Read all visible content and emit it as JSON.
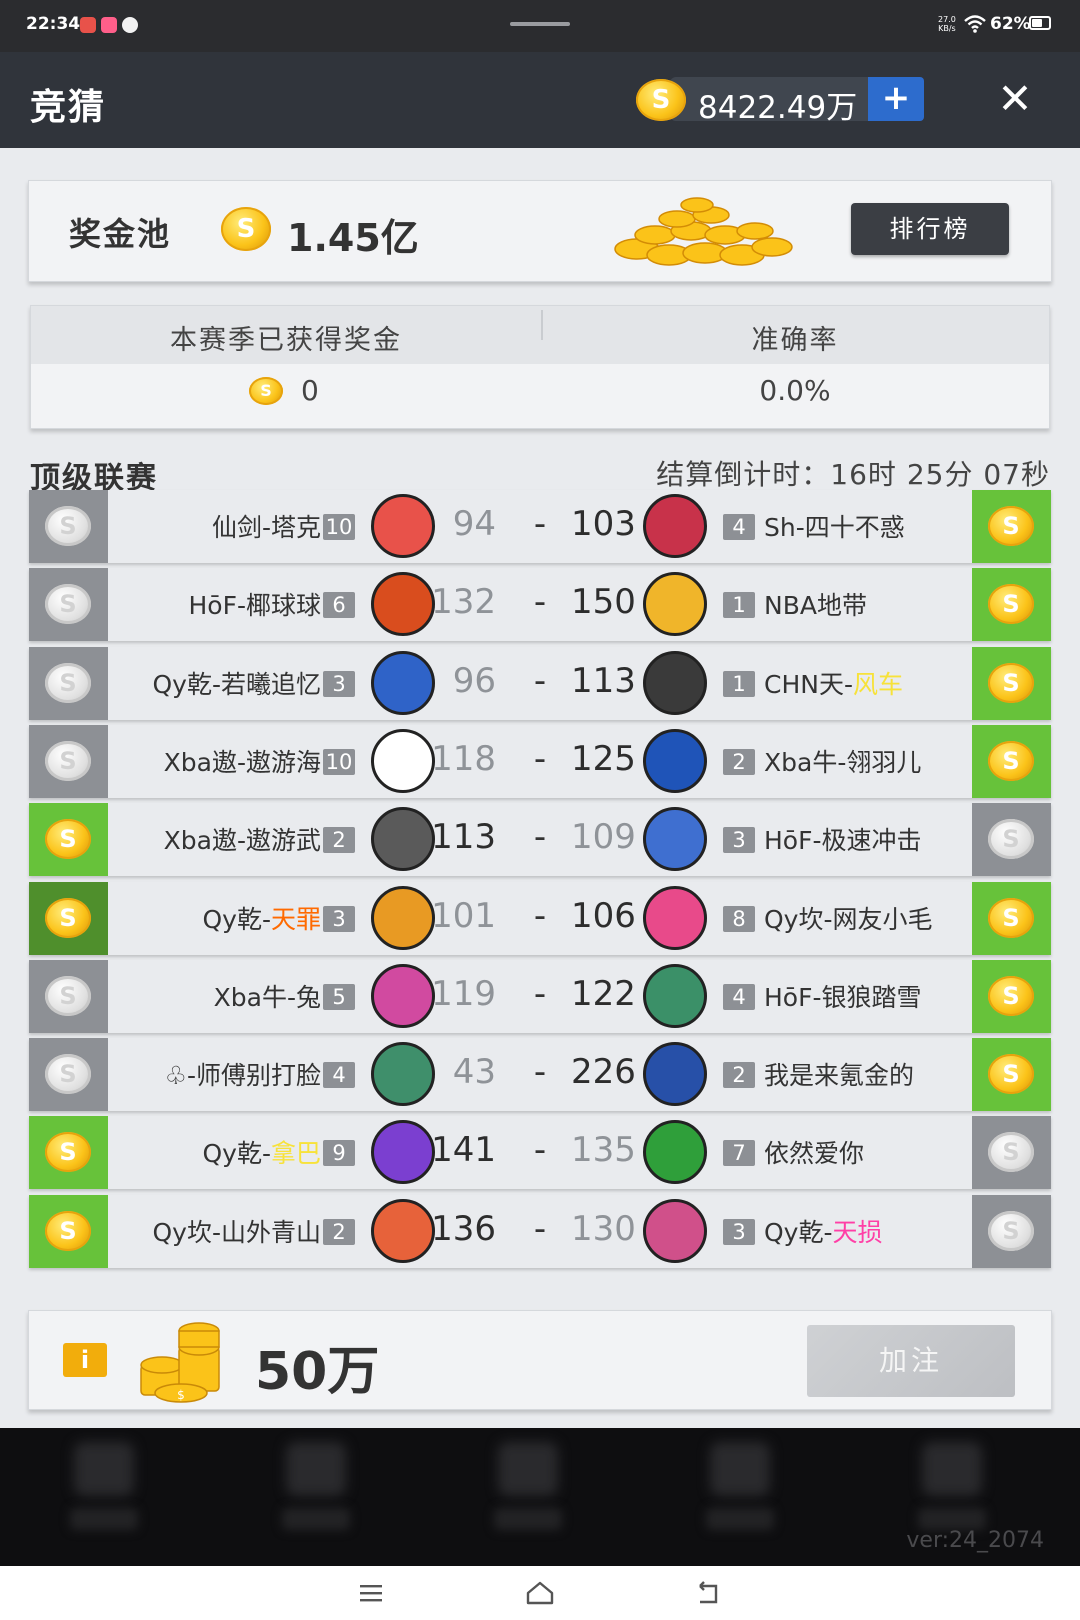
{
  "status_bar": {
    "time": "22:34",
    "net_speed_value": "27.0",
    "net_speed_unit": "KB/s",
    "battery": "62%",
    "battery_level": 0.62
  },
  "header": {
    "title": "竞猜",
    "balance": "8422.49万",
    "add_label": "+",
    "close_label": "✕"
  },
  "pool": {
    "label": "奖金池",
    "value": "1.45亿",
    "rank_label": "排行榜"
  },
  "stats": {
    "earned_label": "本赛季已获得奖金",
    "earned_value": "0",
    "accuracy_label": "准确率",
    "accuracy_value": "0.0%"
  },
  "league": {
    "title": "顶级联赛",
    "countdown": "结算倒计时：16时 25分 07秒"
  },
  "matches": [
    {
      "home_name": "仙剑-塔克",
      "home_level": "10",
      "home_score": "94",
      "away_score": "103",
      "away_level": "4",
      "away_name": "Sh",
      "away_suffix": "-四十不惑",
      "winner": "away"
    },
    {
      "home_name": "HōF-椰球球",
      "home_level": "6",
      "home_score": "132",
      "away_score": "150",
      "away_level": "1",
      "away_name": "NBA地带",
      "winner": "away"
    },
    {
      "home_name": "Qy乾-若曦追忆",
      "home_level": "3",
      "home_score": "96",
      "away_score": "113",
      "away_level": "1",
      "away_name": "CHN天-",
      "away_highlight": "风车",
      "winner": "away"
    },
    {
      "home_name": "Xba遨-遨游海",
      "home_level": "10",
      "home_score": "118",
      "away_score": "125",
      "away_level": "2",
      "away_name": "Xba牛-翎羽儿",
      "winner": "away"
    },
    {
      "home_name": "Xba遨-遨游武",
      "home_level": "2",
      "home_score": "113",
      "away_score": "109",
      "away_level": "3",
      "away_name": "HōF-极速冲击",
      "winner": "home"
    },
    {
      "home_name": "Qy乾-",
      "home_highlight": "天罪",
      "home_level": "3",
      "home_score": "101",
      "away_score": "106",
      "away_level": "8",
      "away_name": "Qy坎-网友小毛",
      "winner": "away"
    },
    {
      "home_name": "Xba牛-兔",
      "home_level": "5",
      "home_score": "119",
      "away_score": "122",
      "away_level": "4",
      "away_name": "HōF-银狼踏雪",
      "winner": "away"
    },
    {
      "home_name": "♧-师傅别打脸",
      "home_level": "4",
      "home_score": "43",
      "away_score": "226",
      "away_level": "2",
      "away_name": "我是来氪金的",
      "winner": "away"
    },
    {
      "home_name": "Qy乾-",
      "home_highlight": "拿巴",
      "home_level": "9",
      "home_score": "141",
      "away_score": "135",
      "away_level": "7",
      "away_name": "依然爱你",
      "winner": "home"
    },
    {
      "home_name": "Qy坎-山外青山",
      "home_level": "2",
      "home_score": "136",
      "away_score": "130",
      "away_level": "3",
      "away_name": "Qy乾-",
      "away_highlight": "天损",
      "winner": "home"
    }
  ],
  "bet": {
    "info_label": "i",
    "amount": "50万",
    "button_label": "加注"
  },
  "footer": {
    "version": "ver:24_2074"
  },
  "colors": {
    "header_bg": "#30343b",
    "accent_blue": "#2d6ccd",
    "win_green": "#67c23a",
    "lose_gray": "#8d9095",
    "coin_gold": "#fbc319",
    "highlight_orange": "#ff6a00",
    "highlight_yellow": "#f7e23a",
    "highlight_pink": "#ff3fa6"
  },
  "icons": {
    "coin": "S"
  }
}
